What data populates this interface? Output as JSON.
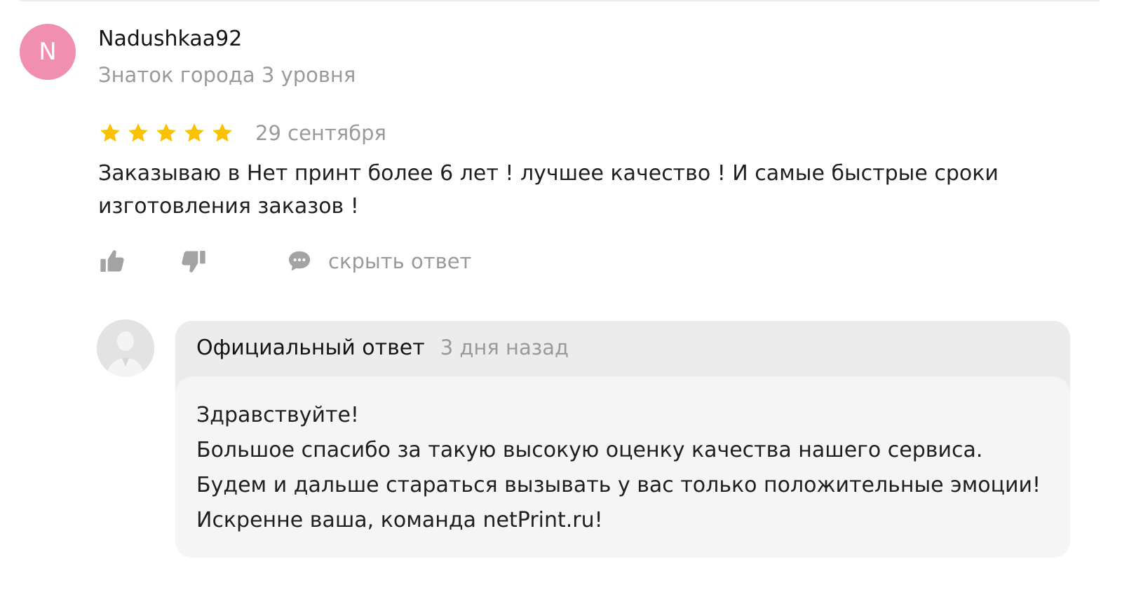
{
  "review": {
    "avatar_letter": "N",
    "avatar_color": "#f08fb0",
    "author": "Nadushkaa92",
    "level": "Знаток города 3 уровня",
    "rating": 5,
    "rating_max": 5,
    "star_color": "#fcc200",
    "date": "29 сентября",
    "text": "Заказываю в Нет принт более 6 лет ! лучшее качество ! И самые быстрые сроки изготовления заказов !",
    "actions": {
      "like_icon": "thumbs-up-icon",
      "dislike_icon": "thumbs-down-icon",
      "comment_icon": "comment-icon",
      "hide_answer_label": "скрыть ответ"
    }
  },
  "reply": {
    "avatar_icon": "organization-avatar-icon",
    "title": "Официальный ответ",
    "date": "3 дня назад",
    "lines": [
      "Здравствуйте!",
      "Большое спасибо за такую высокую оценку качества нашего сервиса.",
      "Будем и дальше стараться вызывать у вас только положительные эмоции!",
      "Искренне ваша, команда netPrint.ru!"
    ]
  }
}
